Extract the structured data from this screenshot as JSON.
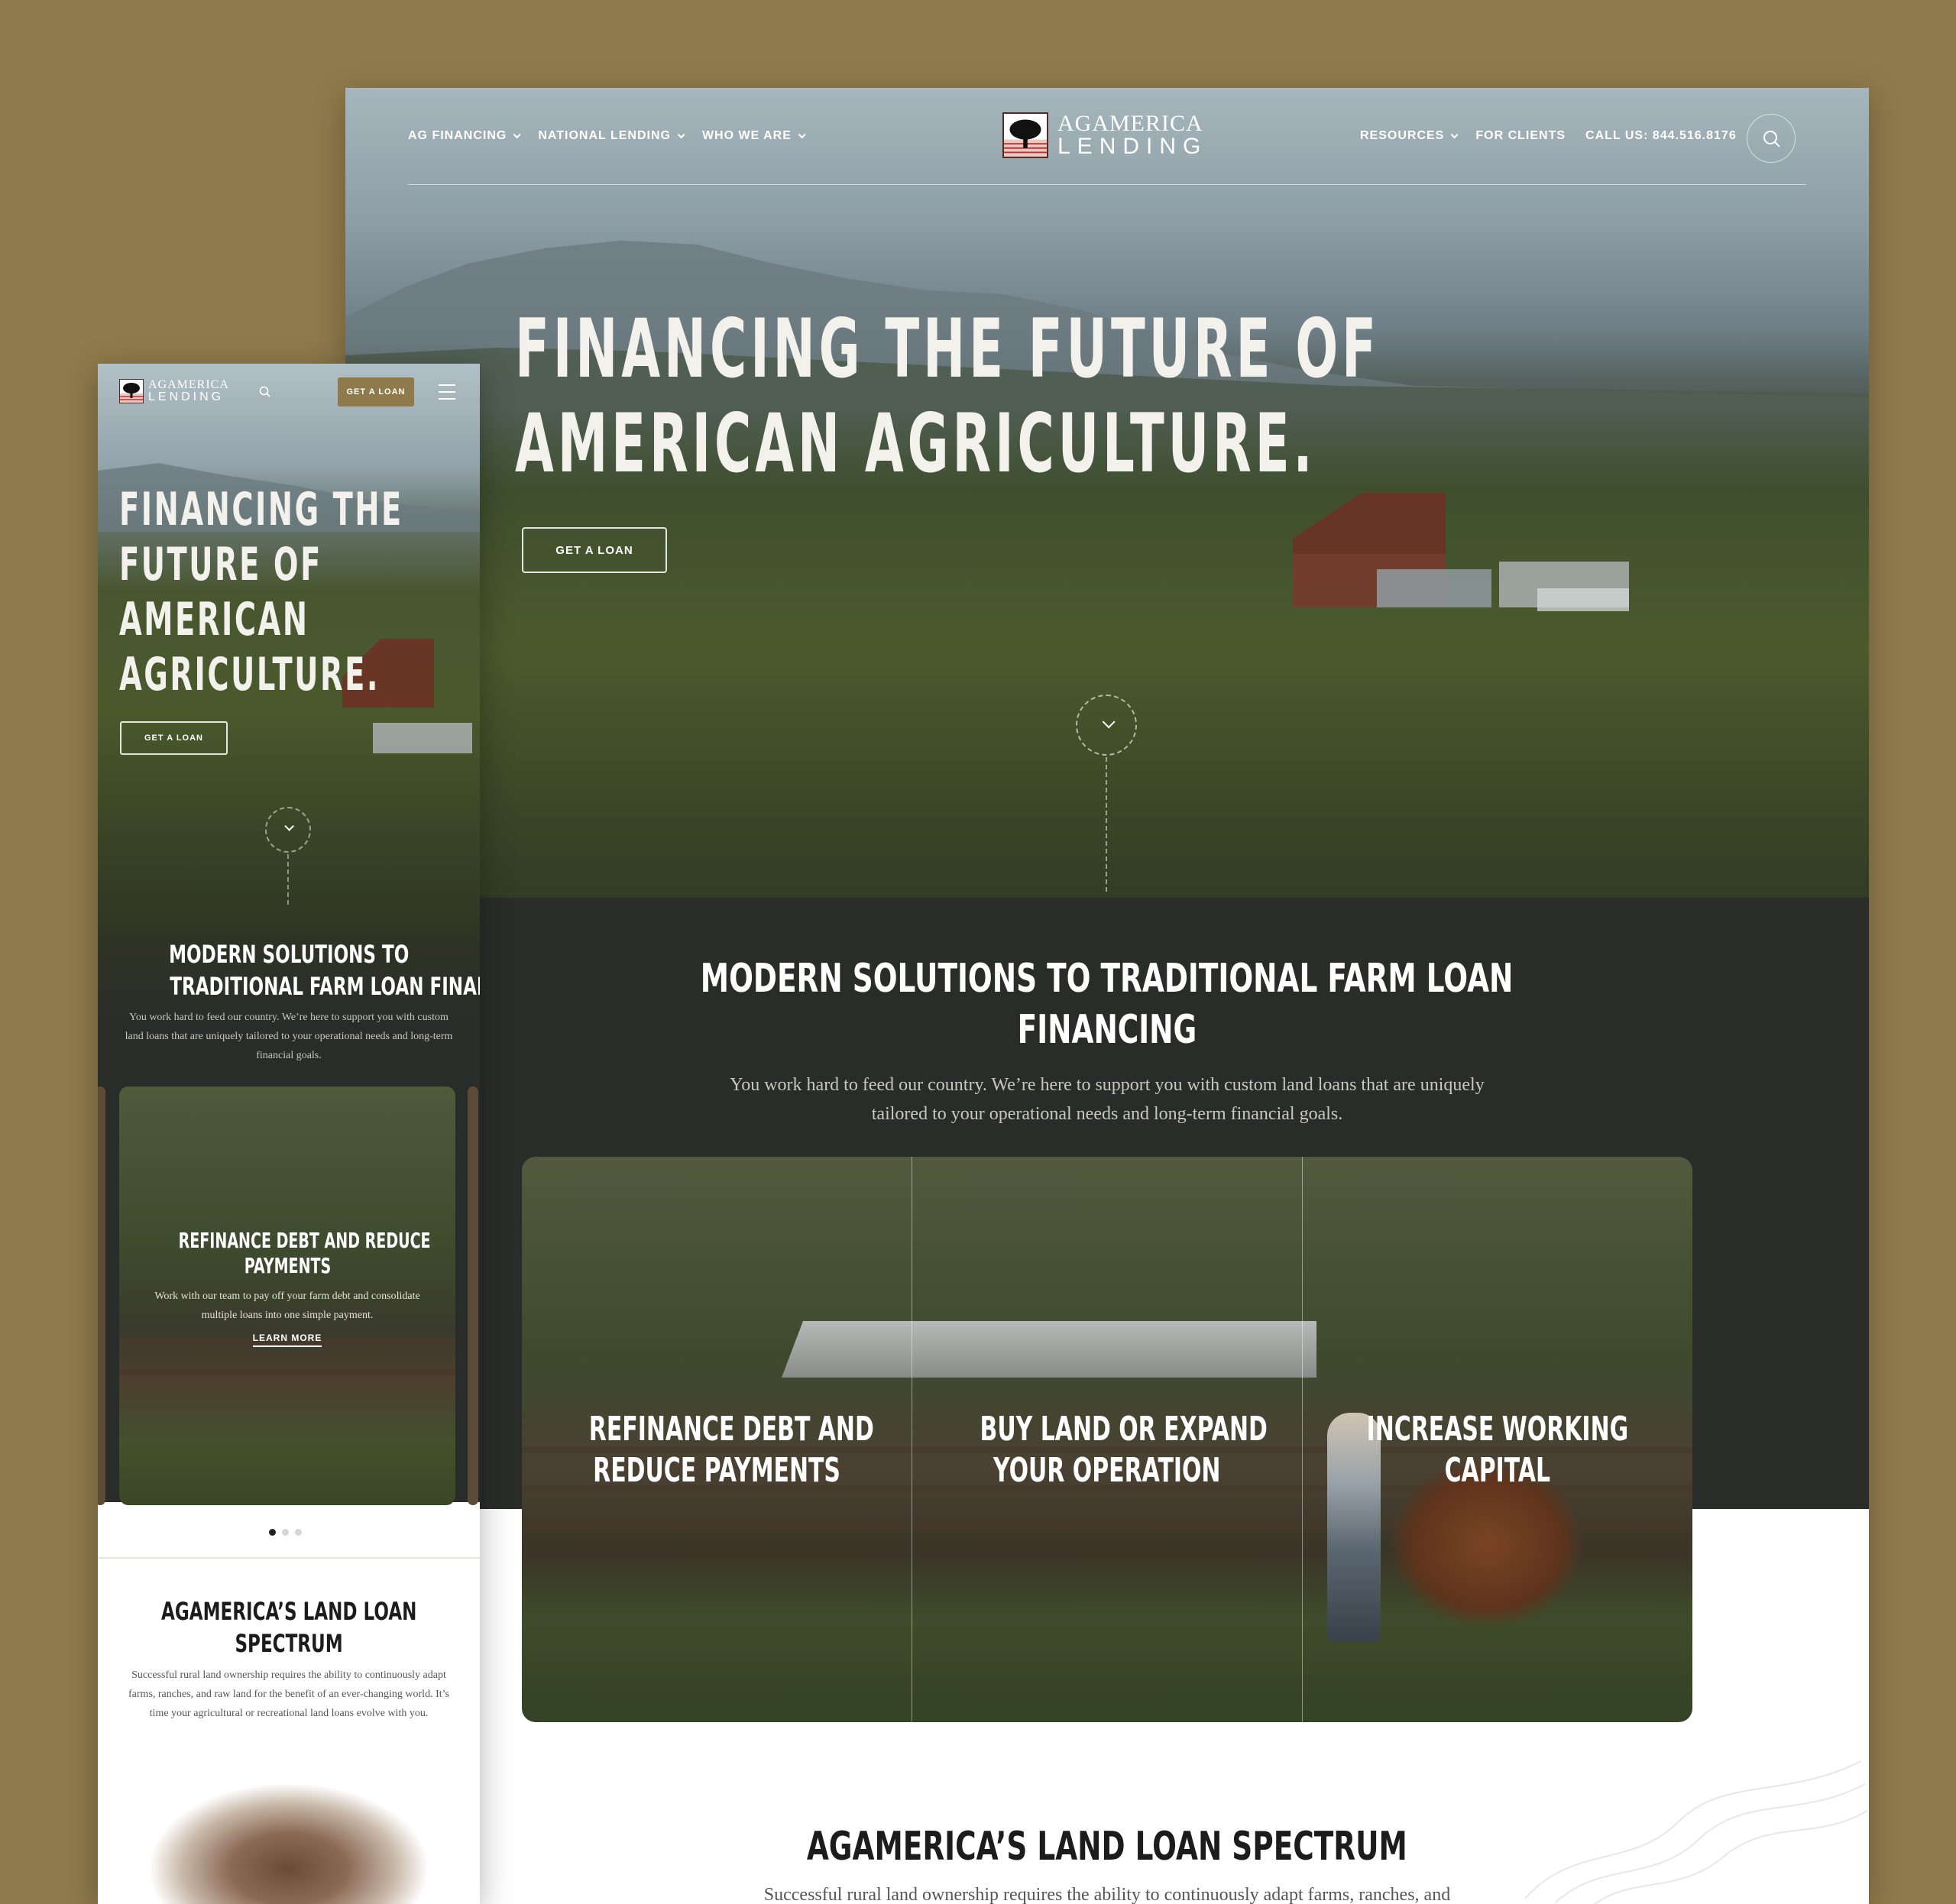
{
  "colors": {
    "page_bg": "#8f7a4b",
    "dark_section": "#2a2c2a",
    "accent_button": "#8f7a4b"
  },
  "desktop": {
    "nav": {
      "left_items": [
        {
          "label": "AG FINANCING",
          "icon": "chevron-down-icon"
        },
        {
          "label": "NATIONAL LENDING",
          "icon": "chevron-down-icon"
        },
        {
          "label": "WHO WE ARE",
          "icon": "chevron-down-icon"
        }
      ],
      "right_items": [
        {
          "label": "RESOURCES",
          "icon": "chevron-down-icon"
        },
        {
          "label": "FOR CLIENTS"
        },
        {
          "label": "CALL US: 844.516.8176"
        }
      ],
      "logo": {
        "line1": "AGAMERICA",
        "line2": "LENDING"
      },
      "search_icon": "search-icon"
    },
    "hero": {
      "title_line1": "FINANCING THE FUTURE OF",
      "title_line2": "AMERICAN AGRICULTURE.",
      "button": "GET A LOAN",
      "scroll_icon": "chevron-down-icon"
    },
    "solutions": {
      "title_line1": "MODERN SOLUTIONS TO TRADITIONAL FARM LOAN",
      "title_line2": "FINANCING",
      "subtitle": "You work hard to feed our country. We’re here to support you with custom land loans that are uniquely tailored to your operational needs and long-term financial goals.",
      "cards": [
        {
          "line1": "REFINANCE DEBT AND",
          "line2": "REDUCE PAYMENTS"
        },
        {
          "line1": "BUY LAND OR EXPAND",
          "line2": "YOUR OPERATION"
        },
        {
          "line1": "INCREASE WORKING",
          "line2": "CAPITAL"
        }
      ]
    },
    "spectrum": {
      "title": "AGAMERICA’S LAND LOAN SPECTRUM",
      "subtitle": "Successful rural land ownership requires the ability to continuously adapt farms, ranches, and"
    }
  },
  "mobile": {
    "logo": {
      "line1": "AGAMERICA",
      "line2": "LENDING"
    },
    "search_icon": "search-icon",
    "get_loan": "GET A LOAN",
    "menu_icon": "hamburger-menu-icon",
    "hero": {
      "title_lines": [
        "FINANCING THE",
        "FUTURE OF",
        "AMERICAN",
        "AGRICULTURE."
      ],
      "button": "GET A LOAN"
    },
    "solutions": {
      "title_line1": "MODERN SOLUTIONS TO",
      "title_line2": "TRADITIONAL FARM LOAN FINANCING",
      "subtitle": "You work hard to feed our country. We’re here to support you with custom land loans that are uniquely tailored to your operational needs and long-term financial goals.",
      "card": {
        "title_line1": "REFINANCE DEBT AND REDUCE",
        "title_line2": "PAYMENTS",
        "description": "Work with our team to pay off your farm debt and consolidate multiple loans into one simple payment.",
        "link": "LEARN MORE"
      },
      "carousel": {
        "current": 1,
        "total": 3
      }
    },
    "spectrum": {
      "title_line1": "AGAMERICA’S LAND LOAN",
      "title_line2": "SPECTRUM",
      "subtitle": "Successful rural land ownership requires the ability to continuously adapt farms, ranches, and raw land for the benefit of an ever-changing world. It’s time your agricultural or recreational land loans evolve with you."
    }
  }
}
